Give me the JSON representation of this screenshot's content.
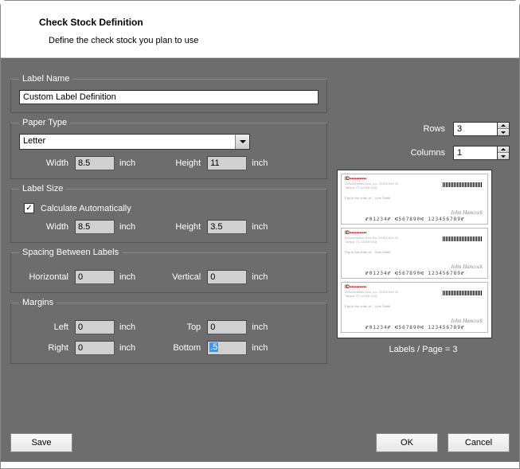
{
  "header": {
    "title": "Check Stock Definition",
    "subtitle": "Define the check stock you plan to use"
  },
  "labelName": {
    "legend": "Label Name",
    "value": "Custom Label Definition"
  },
  "paperType": {
    "legend": "Paper Type",
    "selected": "Letter",
    "widthLabel": "Width",
    "widthValue": "8.5",
    "heightLabel": "Height",
    "heightValue": "11",
    "unit": "inch"
  },
  "labelSize": {
    "legend": "Label Size",
    "checkboxLabel": "Calculate Automatically",
    "widthLabel": "Width",
    "widthValue": "8.5",
    "heightLabel": "Height",
    "heightValue": "3.5",
    "unit": "inch"
  },
  "spacing": {
    "legend": "Spacing Between Labels",
    "hLabel": "Horizontal",
    "hValue": "0",
    "vLabel": "Vertical",
    "vValue": "0",
    "unit": "inch"
  },
  "margins": {
    "legend": "Margins",
    "leftLabel": "Left",
    "leftValue": "0",
    "topLabel": "Top",
    "topValue": "0",
    "rightLabel": "Right",
    "rightValue": "0",
    "bottomLabel": "Bottom",
    "bottomValue": ".5",
    "unit": "inch"
  },
  "layout": {
    "rowsLabel": "Rows",
    "rowsValue": "3",
    "colsLabel": "Columns",
    "colsValue": "1",
    "caption": "Labels / Page = 3"
  },
  "buttons": {
    "save": "Save",
    "ok": "OK",
    "cancel": "Cancel"
  }
}
